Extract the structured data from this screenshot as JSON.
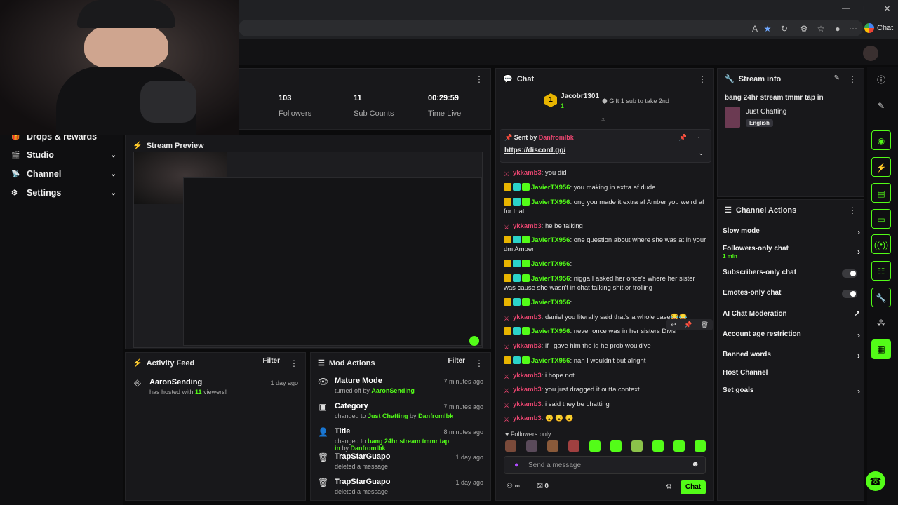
{
  "browser": {
    "chat_label": "Chat"
  },
  "sidebar": {
    "items": [
      {
        "label": "Drops & rewards",
        "icon": "gift-icon",
        "chev": false
      },
      {
        "label": "Studio",
        "icon": "studio-icon",
        "chev": true
      },
      {
        "label": "Channel",
        "icon": "channel-icon",
        "chev": true
      },
      {
        "label": "Settings",
        "icon": "gear-icon",
        "chev": true
      }
    ]
  },
  "stats": [
    {
      "value": "103",
      "label": "Followers"
    },
    {
      "value": "11",
      "label": "Sub Counts"
    },
    {
      "value": "00:29:59",
      "label": "Time Live"
    }
  ],
  "preview": {
    "title": "Stream Preview"
  },
  "activity": {
    "title": "Activity Feed",
    "filter": "Filter",
    "items": [
      {
        "user": "AaronSending",
        "prefix": "has hosted with ",
        "count": "11",
        "suffix": " viewers!",
        "time": "1 day ago"
      }
    ]
  },
  "mod": {
    "title": "Mod Actions",
    "filter": "Filter",
    "items": [
      {
        "title": "Mature Mode",
        "sub1": "turned off by ",
        "hl1": "AaronSending",
        "sub2": "",
        "hl2": "",
        "time": "7 minutes ago",
        "icon": "eye-icon"
      },
      {
        "title": "Category",
        "sub1": "changed to ",
        "hl1": "Just Chatting",
        "sub2": " by ",
        "hl2": "Danfromlbk",
        "time": "7 minutes ago",
        "icon": "category-icon"
      },
      {
        "title": "Title",
        "sub1": "changed to ",
        "hl1": "bang 24hr stream tmmr tap in",
        "sub2": " by ",
        "hl2": "Danfromlbk",
        "time": "8 minutes ago",
        "icon": "user-edit-icon"
      },
      {
        "title": "TrapStarGuapo",
        "sub1": "deleted a message",
        "hl1": "",
        "sub2": "",
        "hl2": "",
        "time": "1 day ago",
        "icon": "trash-icon"
      },
      {
        "title": "TrapStarGuapo",
        "sub1": "deleted a message",
        "hl1": "",
        "sub2": "",
        "hl2": "",
        "time": "1 day ago",
        "icon": "trash-icon"
      }
    ]
  },
  "chat": {
    "title": "Chat",
    "top_gifter": "Jacobr1301",
    "top_gifter_count": "1",
    "gift_prompt": "Gift 1 sub to take 2nd",
    "pinned_by_label": "Sent by",
    "pinned_user": "Danfromlbk",
    "pinned_link": "https://discord.gg/",
    "messages": [
      {
        "user": "ykkamb3",
        "text": ": you did",
        "color": "r",
        "crown": false
      },
      {
        "user": "JavierTX956",
        "text": ": you making in extra af dude",
        "color": "g",
        "crown": true
      },
      {
        "user": "JavierTX956",
        "text": ": ong you made it extra af Amber you weird af for that",
        "color": "g",
        "crown": true
      },
      {
        "user": "ykkamb3",
        "text": ": he be talking",
        "color": "r",
        "crown": false
      },
      {
        "user": "JavierTX956",
        "text": ": one question about where she was at in your dm Amber",
        "color": "g",
        "crown": true
      },
      {
        "user": "JavierTX956",
        "text": ":",
        "color": "g",
        "crown": true
      },
      {
        "user": "JavierTX956",
        "text": ": nigga I asked her once's where her sister was cause she wasn't in chat talking shit or trolling",
        "color": "g",
        "crown": true
      },
      {
        "user": "JavierTX956",
        "text": ":",
        "color": "g",
        "crown": true
      },
      {
        "user": "ykkamb3",
        "text": ": daniel you literally said that's a whole case😂😂",
        "color": "r",
        "crown": false
      },
      {
        "user": "JavierTX956",
        "text": ": never once was in her sisters DMs",
        "color": "g",
        "crown": true
      },
      {
        "user": "ykkamb3",
        "text": ": if i gave him the ig he prob would've",
        "color": "r",
        "crown": false
      },
      {
        "user": "JavierTX956",
        "text": ": nah I wouldn't but alright",
        "color": "g",
        "crown": true
      },
      {
        "user": "ykkamb3",
        "text": ": i hope not",
        "color": "r",
        "crown": false
      },
      {
        "user": "ykkamb3",
        "text": ": you just dragged it outta context",
        "color": "r",
        "crown": false
      },
      {
        "user": "ykkamb3",
        "text": ": i said they be chatting",
        "color": "r",
        "crown": false
      },
      {
        "user": "ykkamb3",
        "text": ": 😮 😮 😮",
        "color": "r",
        "crown": false
      }
    ],
    "followers_only": "Followers only",
    "placeholder": "Send a message",
    "points": "0",
    "send": "Chat"
  },
  "stream_info": {
    "title": "Stream info",
    "stream_title": "bang 24hr stream tmmr tap in",
    "category": "Just Chatting",
    "language": "English"
  },
  "channel_actions": {
    "title": "Channel Actions",
    "items": [
      {
        "label": "Slow mode",
        "type": "arrow",
        "sub": ""
      },
      {
        "label": "Followers-only chat",
        "type": "arrow",
        "sub": "1 min"
      },
      {
        "label": "Subscribers-only chat",
        "type": "toggle",
        "sub": ""
      },
      {
        "label": "Emotes-only chat",
        "type": "toggle",
        "sub": ""
      },
      {
        "label": "AI Chat Moderation",
        "type": "external",
        "sub": ""
      },
      {
        "label": "Account age restriction",
        "type": "arrow",
        "sub": ""
      },
      {
        "label": "Banned words",
        "type": "arrow",
        "sub": ""
      },
      {
        "label": "Host Channel",
        "type": "none",
        "sub": ""
      },
      {
        "label": "Set goals",
        "type": "arrow",
        "sub": ""
      }
    ]
  },
  "colors": {
    "accent": "#53fc18",
    "danger": "#e8456f",
    "panel": "#18181b"
  }
}
